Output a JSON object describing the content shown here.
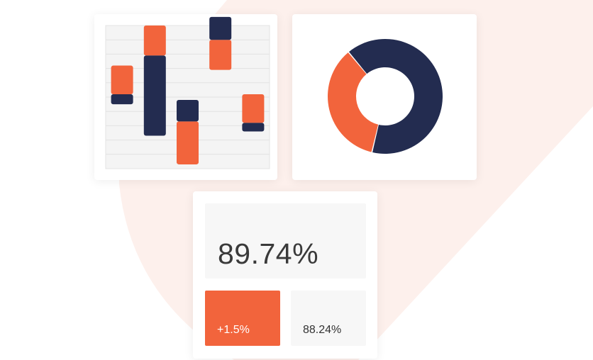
{
  "colors": {
    "accent": "#f2643c",
    "navy": "#232c50",
    "background_shape": "#fdf0ec"
  },
  "chart_data": [
    {
      "type": "bar",
      "title": "",
      "note": "floating stacked bars (orange and navy segments)",
      "ylim": [
        0,
        10
      ],
      "grid": true,
      "categories": [
        "",
        "",
        "",
        "",
        ""
      ],
      "series": [
        {
          "color": "#f2643c",
          "ranges": [
            [
              5.2,
              7.2
            ],
            [
              7.9,
              10
            ],
            [
              0.3,
              3.3
            ],
            [
              6.9,
              9.0
            ],
            [
              3.2,
              5.2
            ]
          ]
        },
        {
          "color": "#232c50",
          "ranges": [
            [
              4.5,
              5.2
            ],
            [
              2.3,
              7.9
            ],
            [
              3.3,
              4.8
            ],
            [
              9.0,
              10.6
            ],
            [
              2.6,
              3.2
            ]
          ]
        }
      ]
    },
    {
      "type": "pie",
      "title": "",
      "note": "donut",
      "values": [
        55,
        30
      ],
      "colors": [
        "#232c50",
        "#f2643c"
      ]
    }
  ],
  "kpi": {
    "main_value": "89.74%",
    "change_value": "+1.5%",
    "previous_value": "88.24%"
  }
}
